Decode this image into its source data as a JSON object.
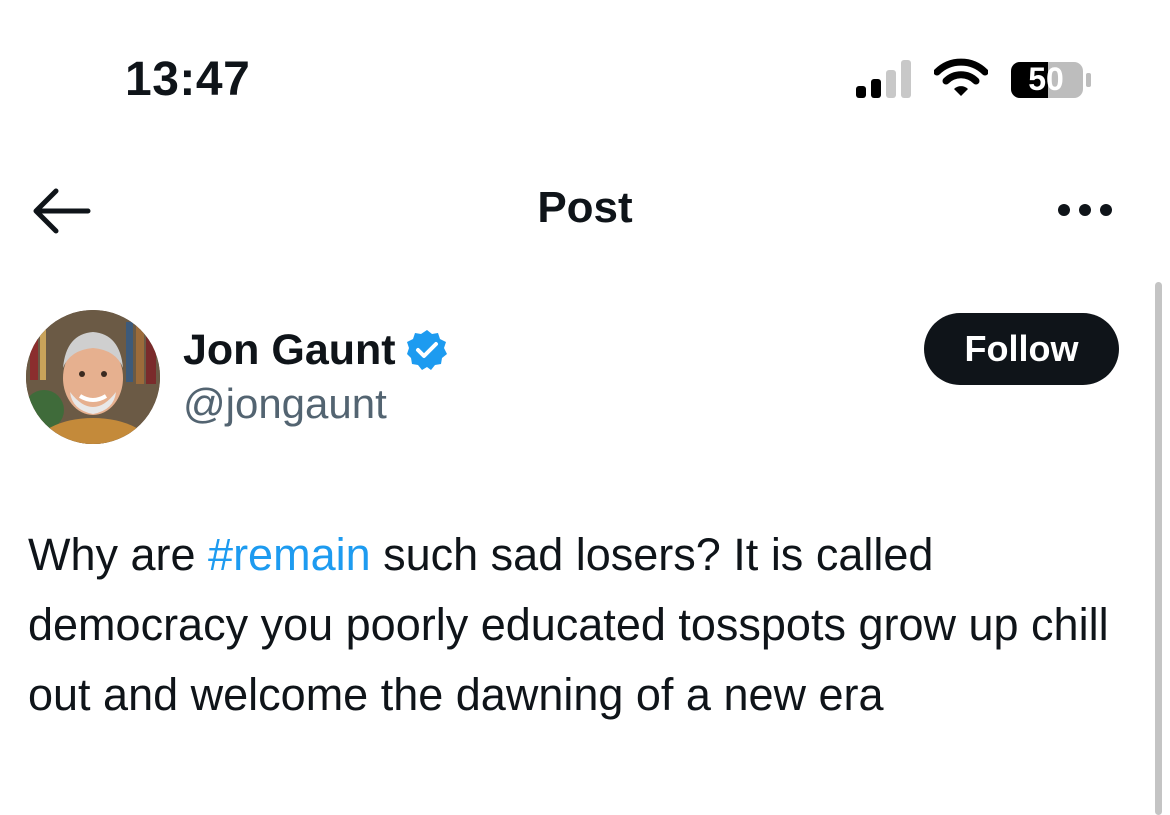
{
  "status_bar": {
    "time": "13:47",
    "battery_level": "50",
    "signal_bars_active": 2,
    "signal_bars_total": 4
  },
  "nav": {
    "title": "Post",
    "back_icon": "arrow-left-icon",
    "more_icon": "more-horizontal-icon"
  },
  "post": {
    "author": {
      "name": "Jon Gaunt",
      "handle": "@jongaunt",
      "verified": true,
      "verified_color": "#1d9bf0"
    },
    "follow_label": "Follow",
    "text_before": "Why are ",
    "hashtag": "#remain",
    "text_after": " such sad losers? It is called democracy you poorly educated tosspots grow up chill out and welcome the dawning of a new era"
  },
  "colors": {
    "text": "#0f1419",
    "secondary": "#536471",
    "accent": "#1d9bf0",
    "button_bg": "#0f1419"
  }
}
